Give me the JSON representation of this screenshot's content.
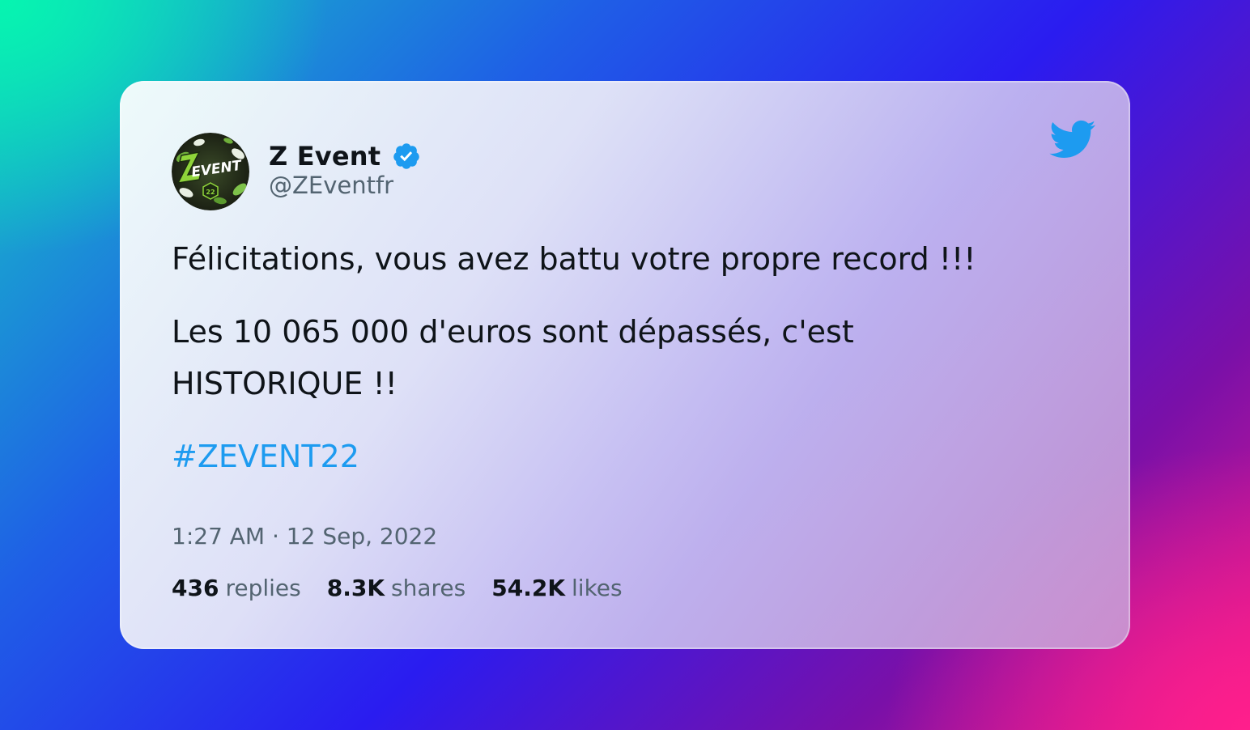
{
  "tweet": {
    "author": {
      "name": "Z Event",
      "handle": "@ZEventfr",
      "verified": true,
      "avatar_icon": "zevent-logo-avatar",
      "avatar_badge_text": "22"
    },
    "paragraphs": [
      "Félicitations, vous avez battu votre propre record !!!",
      "Les 10 065 000 d'euros sont dépassés, c'est HISTORIQUE !!"
    ],
    "hashtag": "#ZEVENT22",
    "timestamp": "1:27 AM · 12 Sep, 2022",
    "stats": {
      "replies": {
        "count": "436",
        "label": "replies"
      },
      "shares": {
        "count": "8.3K",
        "label": "shares"
      },
      "likes": {
        "count": "54.2K",
        "label": "likes"
      }
    }
  },
  "icons": {
    "platform": "twitter-bird-icon",
    "verified": "verified-badge-icon"
  },
  "colors": {
    "twitter_blue": "#1d9bf0",
    "text_primary": "#0f1419",
    "text_secondary": "#536471"
  }
}
